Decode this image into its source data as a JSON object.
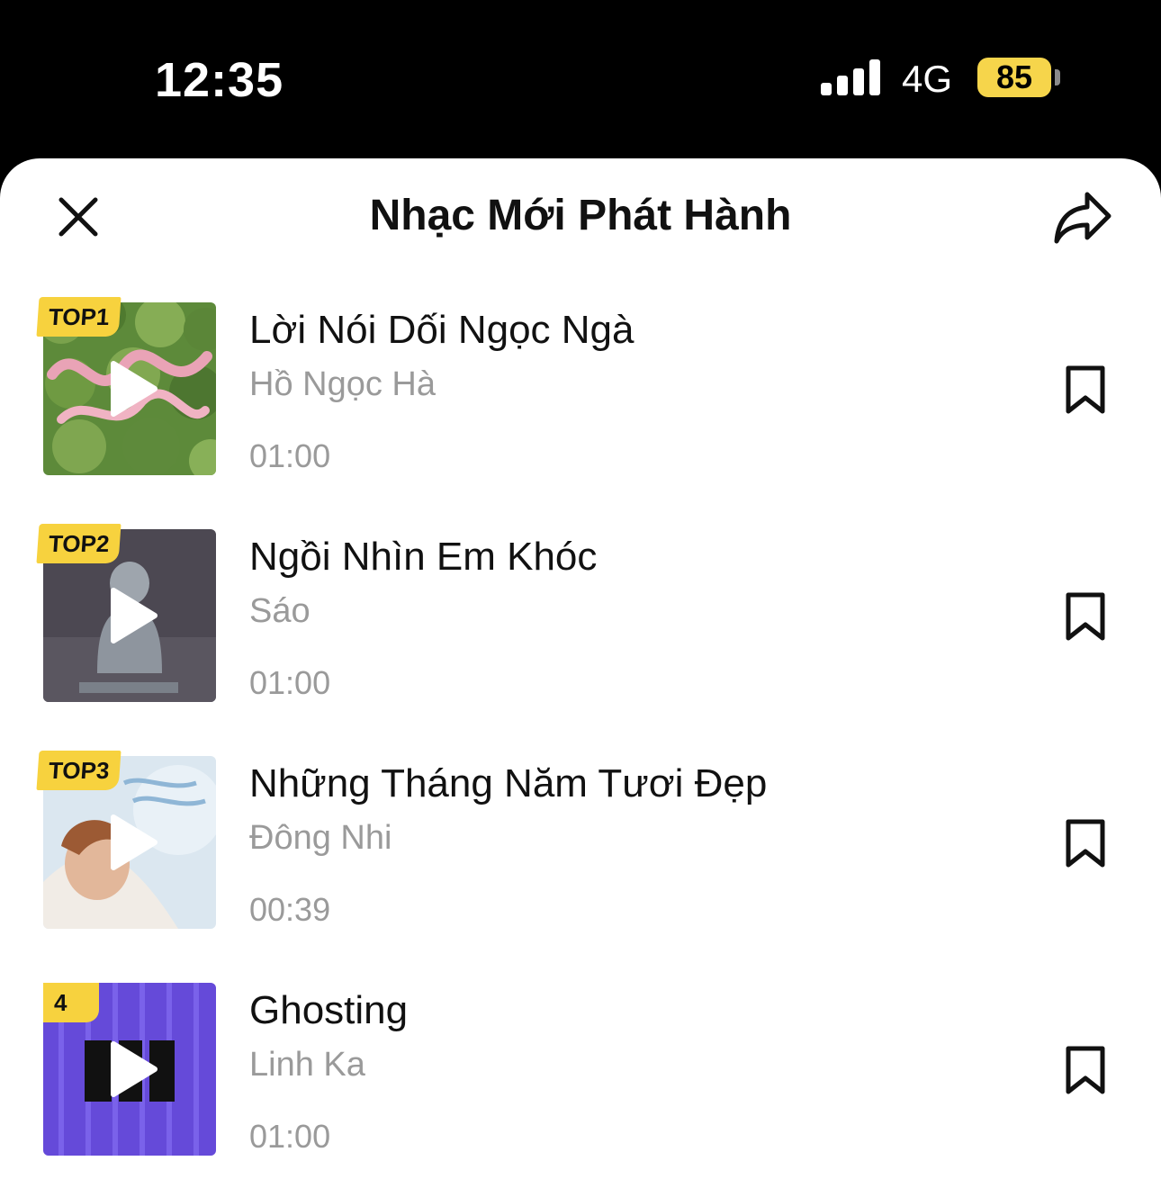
{
  "status_bar": {
    "time": "12:35",
    "network": "4G",
    "battery": "85"
  },
  "header": {
    "title": "Nhạc Mới Phát Hành"
  },
  "songs": [
    {
      "rank": "TOP1",
      "title": "Lời Nói Dối Ngọc Ngà",
      "artist": "Hồ Ngọc Hà",
      "duration": "01:00"
    },
    {
      "rank": "TOP2",
      "title": "Ngồi Nhìn Em Khóc",
      "artist": "Sáo",
      "duration": "01:00"
    },
    {
      "rank": "TOP3",
      "title": "Những Tháng Năm Tươi Đẹp",
      "artist": "Đông Nhi",
      "duration": "00:39"
    },
    {
      "rank": "4",
      "title": "Ghosting",
      "artist": "Linh Ka",
      "duration": "01:00"
    }
  ],
  "colors": {
    "accent_badge": "#f7d23e",
    "battery": "#f6d54b",
    "text_secondary": "#9a9a9a"
  },
  "icons": {
    "close": "close-icon",
    "share": "share-icon",
    "play": "play-icon",
    "bookmark": "bookmark-icon"
  }
}
